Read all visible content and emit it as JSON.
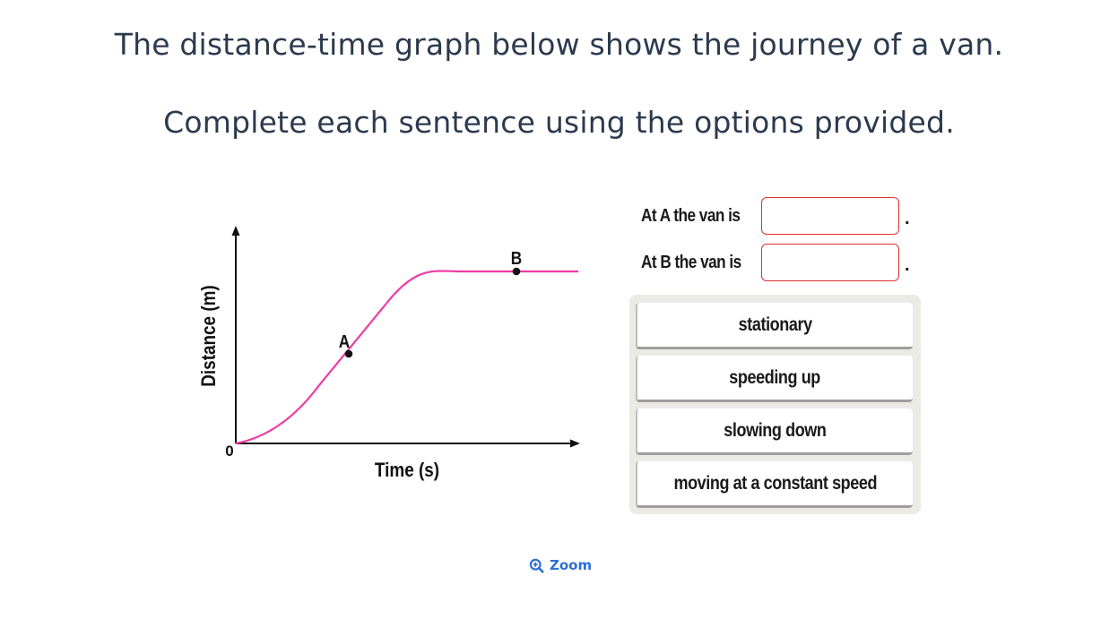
{
  "heading": {
    "line1": "The distance-time graph below shows the journey of a van.",
    "line2": "Complete each sentence using the options provided."
  },
  "graph": {
    "y_axis_label": "Distance (m)",
    "x_axis_label": "Time (s)",
    "origin_label": "0",
    "curve_color": "#ee3ba6",
    "points": [
      {
        "label": "A"
      },
      {
        "label": "B"
      }
    ]
  },
  "sentences": [
    {
      "text": "At A the van is",
      "end": "."
    },
    {
      "text": "At B the van is",
      "end": "."
    }
  ],
  "options": [
    {
      "label": "stationary"
    },
    {
      "label": "speeding up"
    },
    {
      "label": "slowing down"
    },
    {
      "label": "moving at a constant speed"
    }
  ],
  "zoom": {
    "label": "Zoom",
    "icon": "zoom-in-icon",
    "color": "#2f6fd6"
  },
  "colors": {
    "drop_box_border": "#e0332f",
    "options_panel": "#eceae5"
  }
}
